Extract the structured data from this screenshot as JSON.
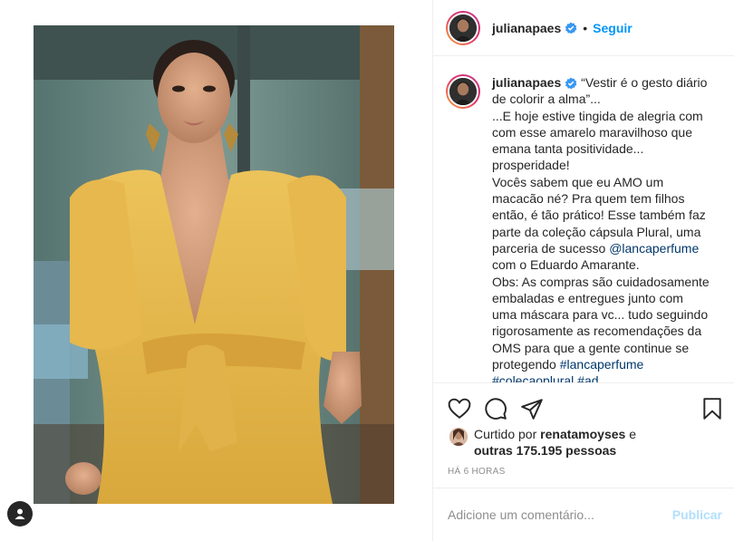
{
  "post": {
    "username": "julianapaes",
    "follow_label": "Seguir",
    "separator": "•",
    "icons": {
      "verified": "verified-badge-icon",
      "like": "heart-icon",
      "comment": "comment-icon",
      "share": "share-icon",
      "save": "bookmark-icon",
      "user_tag": "user-tag-icon"
    },
    "colors": {
      "link": "#0095f6",
      "mention": "#00376b",
      "verified": "#3897f0",
      "muted": "#8e8e8e"
    }
  },
  "caption": {
    "username": "julianapaes",
    "lines": [
      "“Vestir é o gesto diário",
      "de colorir a alma”...",
      "...E hoje estive tingida de alegria com",
      "com esse amarelo maravilhoso que",
      "emana tanta positividade...",
      "prosperidade!",
      "Vocês sabem que eu AMO um",
      "macacão né? Pra quem tem filhos",
      "então, é tão prático! Esse também faz",
      "parte da coleção cápsula Plural, uma",
      "parceria de sucesso",
      "@lancaperfume",
      "com o Eduardo Amarante.",
      "Obs: As compras são cuidadosamente",
      "embaladas e entregues junto com",
      "uma máscara para vc... tudo seguindo",
      "rigorosamente as recomendações da",
      "OMS para que a gente continue se",
      "protegendo",
      "#lancaperfume",
      "#colecaoplural #ad"
    ]
  },
  "likes": {
    "prefix": "Curtido por",
    "liker": "renatamoyses",
    "conj": "e",
    "others": "outras 175.195 pessoas"
  },
  "timestamp": "HÁ 6 HORAS",
  "comment": {
    "placeholder": "Adicione um comentário...",
    "publish_label": "Publicar"
  }
}
